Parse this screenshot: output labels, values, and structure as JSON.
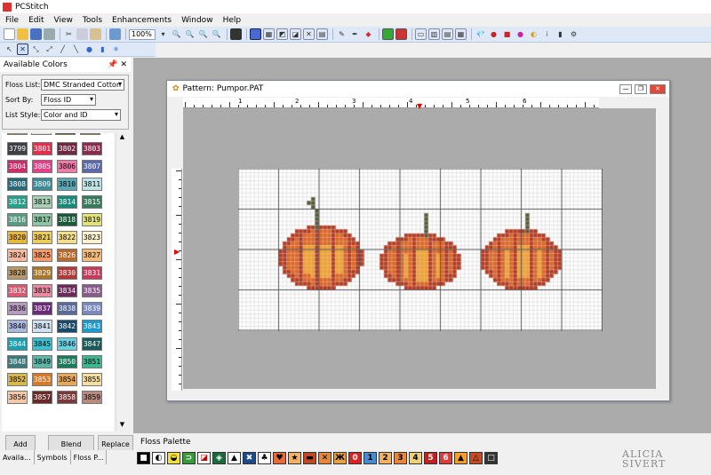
{
  "app": {
    "title": "PCStitch"
  },
  "menu": [
    "File",
    "Edit",
    "View",
    "Tools",
    "Enhancements",
    "Window",
    "Help"
  ],
  "toolbar": {
    "zoom": "100%"
  },
  "colors_panel": {
    "title": "Available Colors",
    "floss_list_label": "Floss List:",
    "floss_list_value": "DMC Stranded Cotton",
    "sort_label": "Sort By:",
    "sort_value": "Floss ID",
    "style_label": "List Style:",
    "style_value": "Color and ID",
    "buttons": [
      "Add",
      "Blend",
      "Replace"
    ]
  },
  "swatches": [
    {
      "id": "3799",
      "c": "#3e3f44"
    },
    {
      "id": "3801",
      "c": "#e2304c"
    },
    {
      "id": "3802",
      "c": "#6e2840"
    },
    {
      "id": "3803",
      "c": "#8c2a4e"
    },
    {
      "id": "3804",
      "c": "#d02b6b"
    },
    {
      "id": "3805",
      "c": "#e2418a"
    },
    {
      "id": "3806",
      "c": "#f07aa9"
    },
    {
      "id": "3807",
      "c": "#5a6aa8"
    },
    {
      "id": "3808",
      "c": "#2a6a78"
    },
    {
      "id": "3809",
      "c": "#3e8a96"
    },
    {
      "id": "3810",
      "c": "#5aa6b2"
    },
    {
      "id": "3811",
      "c": "#bfe2e6"
    },
    {
      "id": "3812",
      "c": "#2aa08a"
    },
    {
      "id": "3813",
      "c": "#a6cfb6"
    },
    {
      "id": "3814",
      "c": "#1a8a78"
    },
    {
      "id": "3815",
      "c": "#3a7a5c"
    },
    {
      "id": "3816",
      "c": "#5a9a82"
    },
    {
      "id": "3817",
      "c": "#8cc4a4"
    },
    {
      "id": "3818",
      "c": "#1a5a3a"
    },
    {
      "id": "3819",
      "c": "#e2e27a"
    },
    {
      "id": "3820",
      "c": "#e8b83a"
    },
    {
      "id": "3821",
      "c": "#eccb5a"
    },
    {
      "id": "3822",
      "c": "#f2dd8a"
    },
    {
      "id": "3823",
      "c": "#fbf3d0"
    },
    {
      "id": "3824",
      "c": "#f5b9a0"
    },
    {
      "id": "3825",
      "c": "#f59a6a"
    },
    {
      "id": "3826",
      "c": "#b8692e"
    },
    {
      "id": "3827",
      "c": "#f2bb7a"
    },
    {
      "id": "3828",
      "c": "#b89a6a"
    },
    {
      "id": "3829",
      "c": "#a8782a"
    },
    {
      "id": "3830",
      "c": "#b03a3a"
    },
    {
      "id": "3831",
      "c": "#c83a5a"
    },
    {
      "id": "3832",
      "c": "#d85a72"
    },
    {
      "id": "3833",
      "c": "#e88aa0"
    },
    {
      "id": "3834",
      "c": "#6a2a5a"
    },
    {
      "id": "3835",
      "c": "#8a5a8a"
    },
    {
      "id": "3836",
      "c": "#b89ac0"
    },
    {
      "id": "3837",
      "c": "#6a2a7a"
    },
    {
      "id": "3838",
      "c": "#5a6a9a"
    },
    {
      "id": "3839",
      "c": "#7a8ac0"
    },
    {
      "id": "3840",
      "c": "#aab8e0"
    },
    {
      "id": "3841",
      "c": "#cfe0f0"
    },
    {
      "id": "3842",
      "c": "#1a4a6a"
    },
    {
      "id": "3843",
      "c": "#1a9ad0"
    },
    {
      "id": "3844",
      "c": "#1aa0b0"
    },
    {
      "id": "3845",
      "c": "#3ac0d0"
    },
    {
      "id": "3846",
      "c": "#6ad0e0"
    },
    {
      "id": "3847",
      "c": "#1a5a5a"
    },
    {
      "id": "3848",
      "c": "#3a7a7a"
    },
    {
      "id": "3849",
      "c": "#5ab8a8"
    },
    {
      "id": "3850",
      "c": "#1a7a5a"
    },
    {
      "id": "3851",
      "c": "#3ab890"
    },
    {
      "id": "3852",
      "c": "#d8b84a"
    },
    {
      "id": "3853",
      "c": "#d8782a"
    },
    {
      "id": "3854",
      "c": "#e8a85a"
    },
    {
      "id": "3855",
      "c": "#f5dca0"
    },
    {
      "id": "3856",
      "c": "#f5c8a8"
    },
    {
      "id": "3857",
      "c": "#6a2a2a"
    },
    {
      "id": "3858",
      "c": "#7a3a3a"
    },
    {
      "id": "3859",
      "c": "#b88a80"
    }
  ],
  "bottom_tabs": [
    "Availa...",
    "Symbols",
    "Floss P..."
  ],
  "child_window": {
    "title": "Pattern: Pumpor.PAT"
  },
  "ruler": [
    "1",
    "2",
    "3",
    "4",
    "5",
    "6"
  ],
  "floss_palette": {
    "label": "Floss Palette",
    "numbers": [
      "0",
      "1",
      "2",
      "3",
      "4",
      "5",
      "6"
    ]
  },
  "colors": {
    "pumpkin_dark": "#b8381e",
    "pumpkin_mid": "#e2641e",
    "pumpkin_light": "#f5a02a",
    "stem": "#5a5a3a"
  },
  "watermark": "ALICIA SIVERT"
}
